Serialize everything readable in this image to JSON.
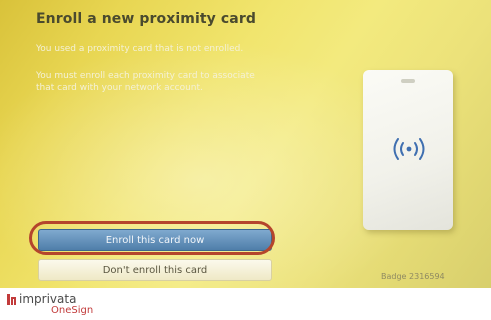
{
  "dialog": {
    "title": "Enroll a new proximity card",
    "message_line1": "You used a proximity card that is not enrolled.",
    "message_line2": "You must enroll each proximity card to associate",
    "message_line3": "that card with your network account."
  },
  "buttons": {
    "enroll_label": "Enroll this card now",
    "skip_label": "Don't enroll this card"
  },
  "badge": {
    "text": "Badge 2316594"
  },
  "footer": {
    "brand": "imprivata",
    "product": "OneSign"
  },
  "icons": {
    "card": "proximity-card-icon",
    "rfid": "rfid-waves-icon",
    "logo": "imprivata-logo-icon"
  },
  "colors": {
    "dialog_bg": "#f1e56e",
    "primary_button": "#5a88b3",
    "highlight_ring": "#b4452c",
    "brand_red": "#c23b3b"
  }
}
